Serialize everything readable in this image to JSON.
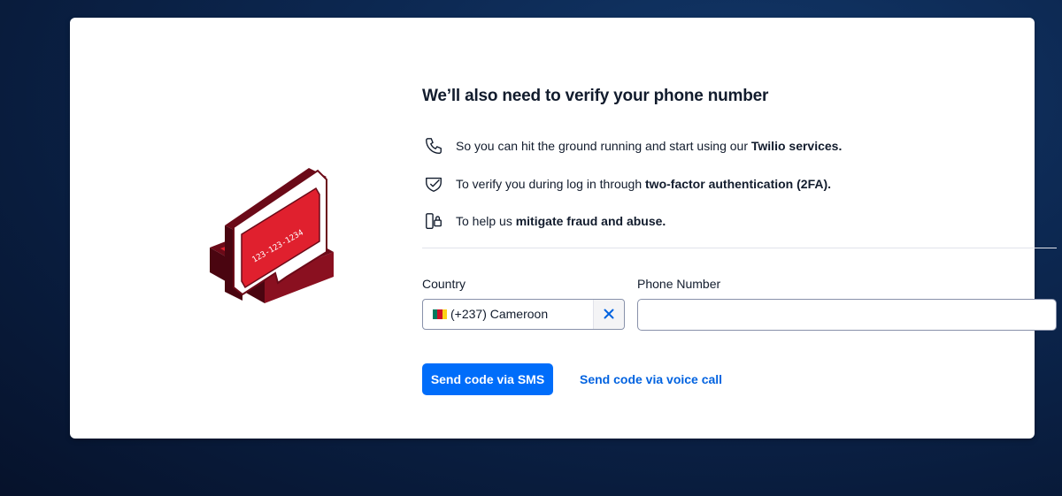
{
  "heading": "We’ll also need to verify your phone number",
  "illustration": {
    "icon": "phone-chat-bubble-illustration",
    "text": "123-123-1234"
  },
  "reasons": [
    {
      "icon": "phone-icon",
      "prefix": "So you can hit the ground running and start using our ",
      "bold": "Twilio services."
    },
    {
      "icon": "shield-check-icon",
      "prefix": "To verify you during log in through ",
      "bold": "two-factor authentication (2FA)."
    },
    {
      "icon": "fraud-lock-icon",
      "prefix": "To help us ",
      "bold": "mitigate fraud and abuse."
    }
  ],
  "form": {
    "country": {
      "label": "Country",
      "value": "(+237) Cameroon",
      "flag_icon": "cameroon-flag-icon",
      "clear_icon": "close-icon"
    },
    "phone": {
      "label": "Phone Number",
      "value": "",
      "placeholder": ""
    }
  },
  "actions": {
    "sms_label": "Send code via SMS",
    "voice_label": "Send code via voice call"
  },
  "colors": {
    "primary": "#006dfa",
    "link": "#0263e0",
    "accent_red": "#e0202e",
    "dark_red": "#6b0a18"
  }
}
